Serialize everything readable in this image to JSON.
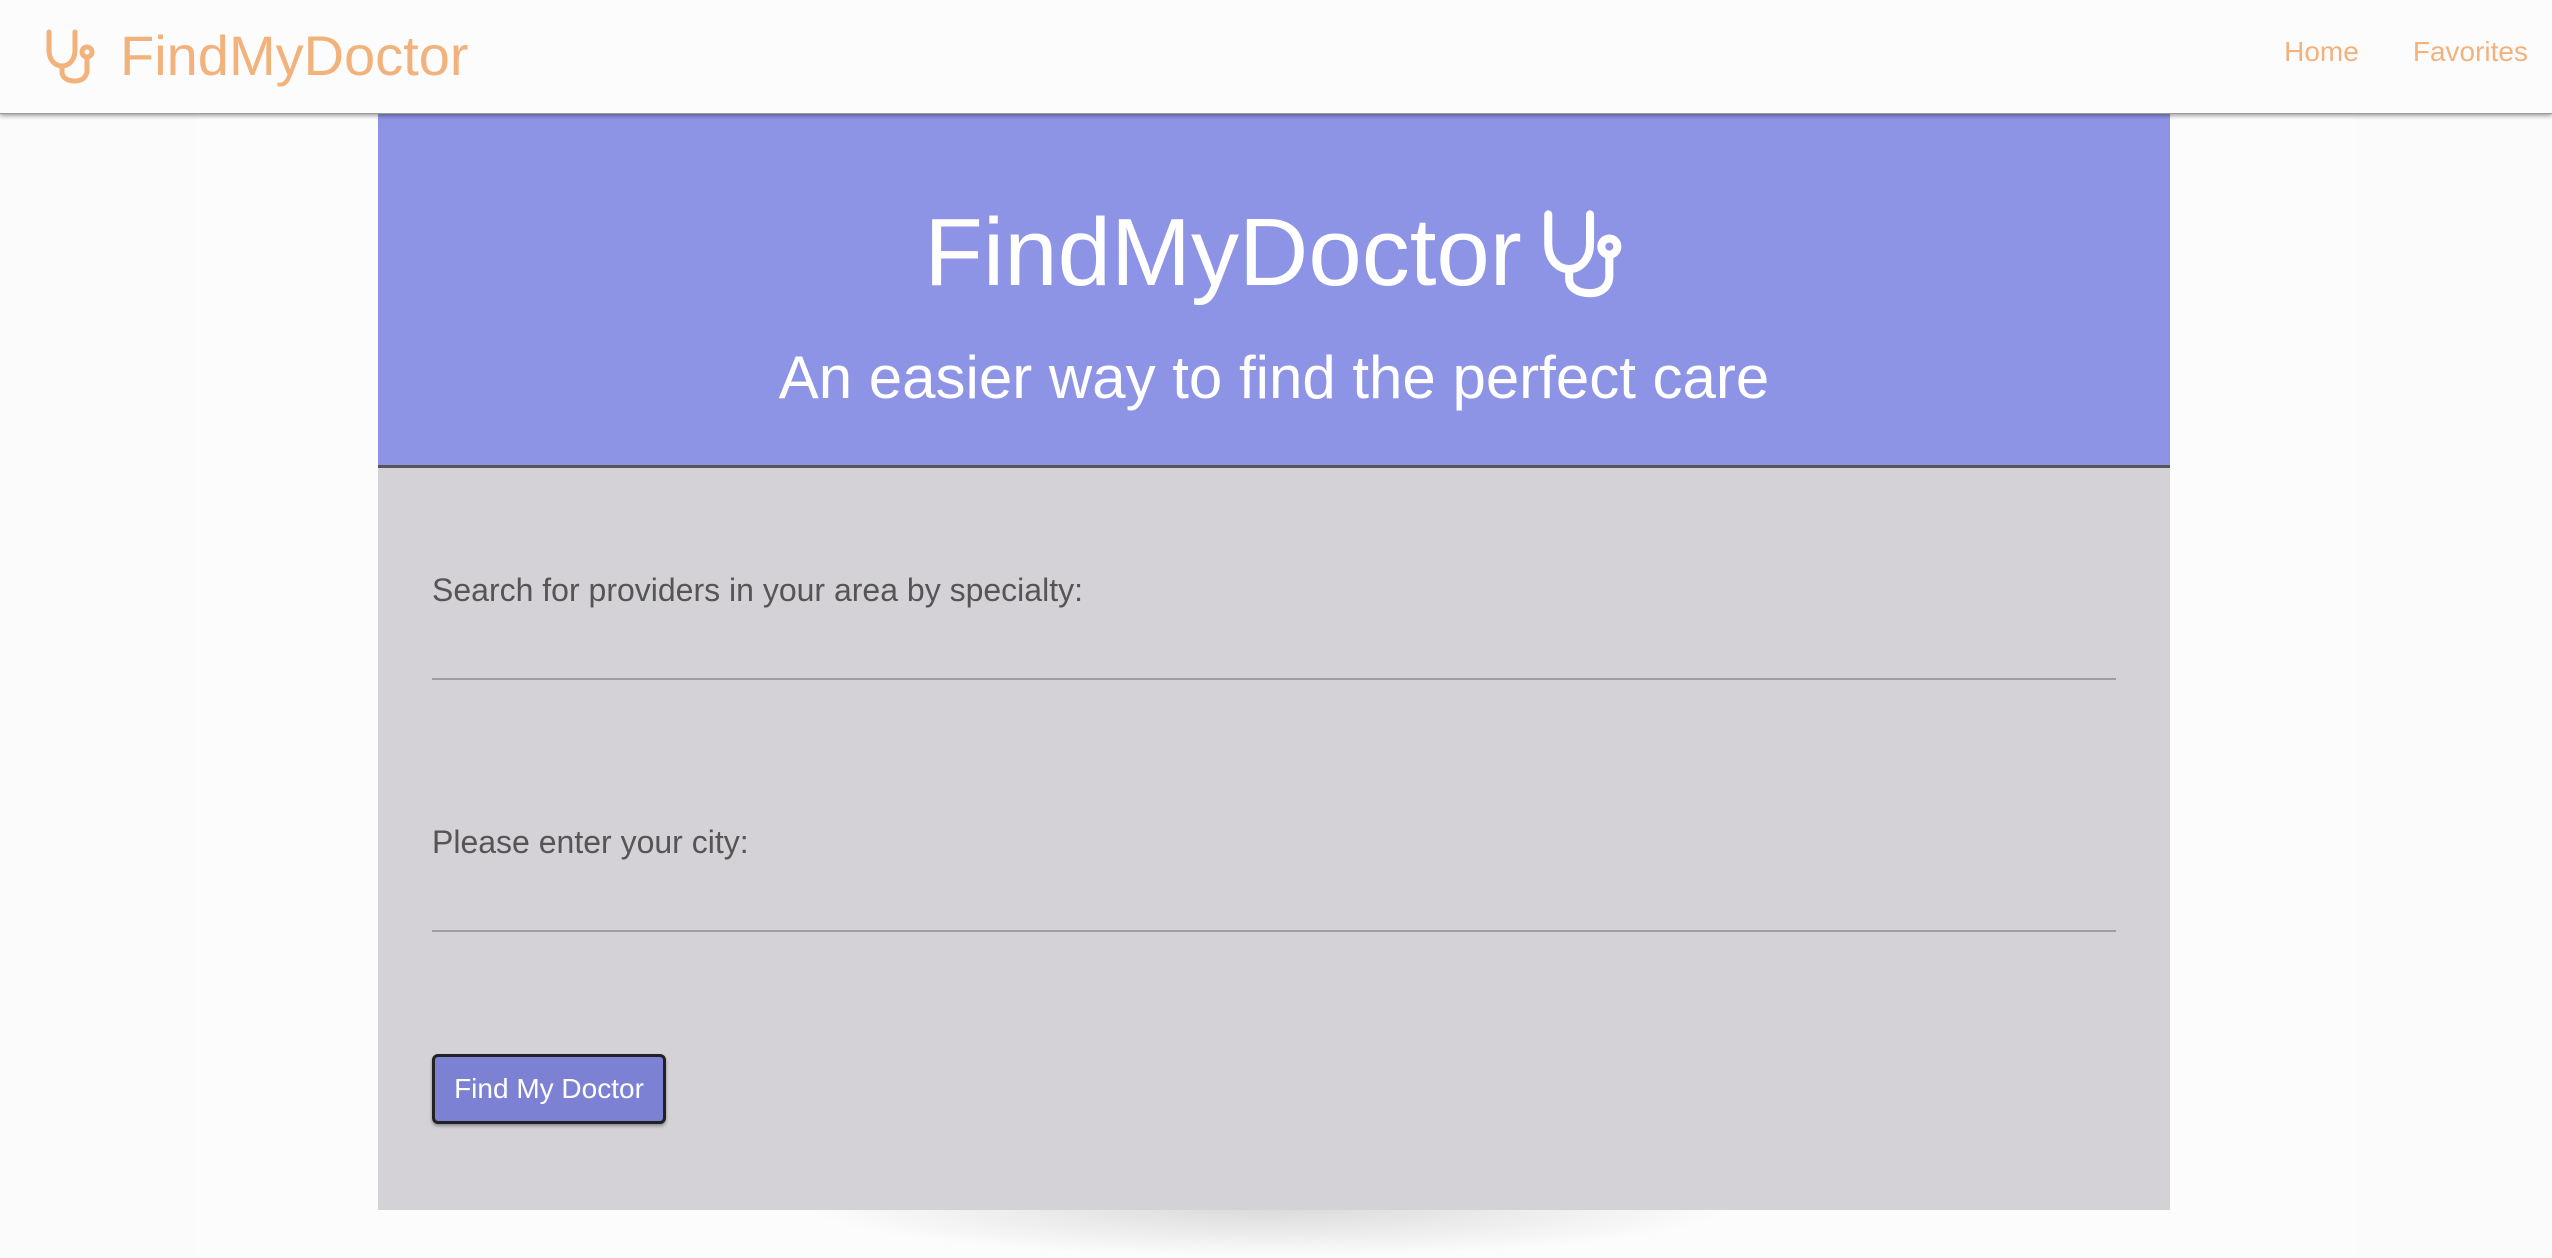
{
  "nav": {
    "brand": "FindMyDoctor",
    "links": [
      {
        "label": "Home"
      },
      {
        "label": "Favorites"
      }
    ]
  },
  "hero": {
    "title": "FindMyDoctor",
    "subtitle": "An easier way to find the perfect care"
  },
  "form": {
    "specialty_label": "Search for providers in your area by specialty:",
    "specialty_value": "",
    "city_label": "Please enter your city:",
    "city_value": "",
    "submit_label": "Find My Doctor"
  },
  "icons": {
    "brand_icon": "stethoscope-icon",
    "hero_icon": "stethoscope-icon"
  },
  "colors": {
    "accent": "#f2b27c",
    "hero_bg": "#8e94e5",
    "form_bg": "#d4d2d6",
    "button_bg": "#7c81d4"
  }
}
